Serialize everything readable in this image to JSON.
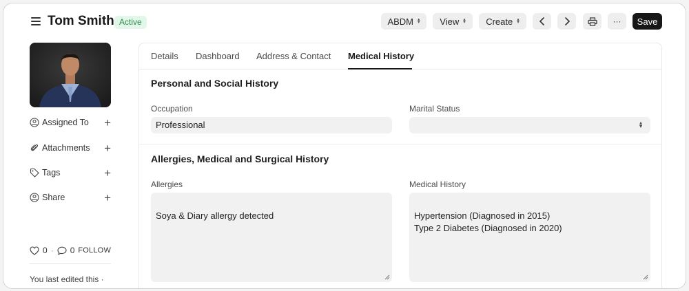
{
  "header": {
    "title": "Tom Smith",
    "status": "Active",
    "buttons": {
      "abdm": "ABDM",
      "view": "View",
      "create": "Create",
      "more": "···",
      "save": "Save"
    }
  },
  "sidebar": {
    "items": [
      {
        "label": "Assigned To"
      },
      {
        "label": "Attachments"
      },
      {
        "label": "Tags"
      },
      {
        "label": "Share"
      }
    ],
    "likes": "0",
    "comments": "0",
    "follow": "FOLLOW",
    "separator": "·",
    "last_edited": "You last edited this ·"
  },
  "tabs": [
    {
      "label": "Details"
    },
    {
      "label": "Dashboard"
    },
    {
      "label": "Address & Contact"
    },
    {
      "label": "Medical History",
      "active": true
    }
  ],
  "sections": {
    "personal": {
      "title": "Personal and Social History",
      "occupation_label": "Occupation",
      "occupation_value": "Professional",
      "marital_label": "Marital Status",
      "marital_value": ""
    },
    "allergies": {
      "title": "Allergies, Medical and Surgical History",
      "allergies_label": "Allergies",
      "allergies_value": "Soya & Diary allergy detected",
      "medical_label": "Medical History",
      "medical_value": "Hypertension (Diagnosed in 2015)\nType 2 Diabetes (Diagnosed in 2020)"
    }
  },
  "colors": {
    "badge_bg": "#e2f6e9",
    "badge_text": "#2f8a4c",
    "save_bg": "#171717"
  }
}
